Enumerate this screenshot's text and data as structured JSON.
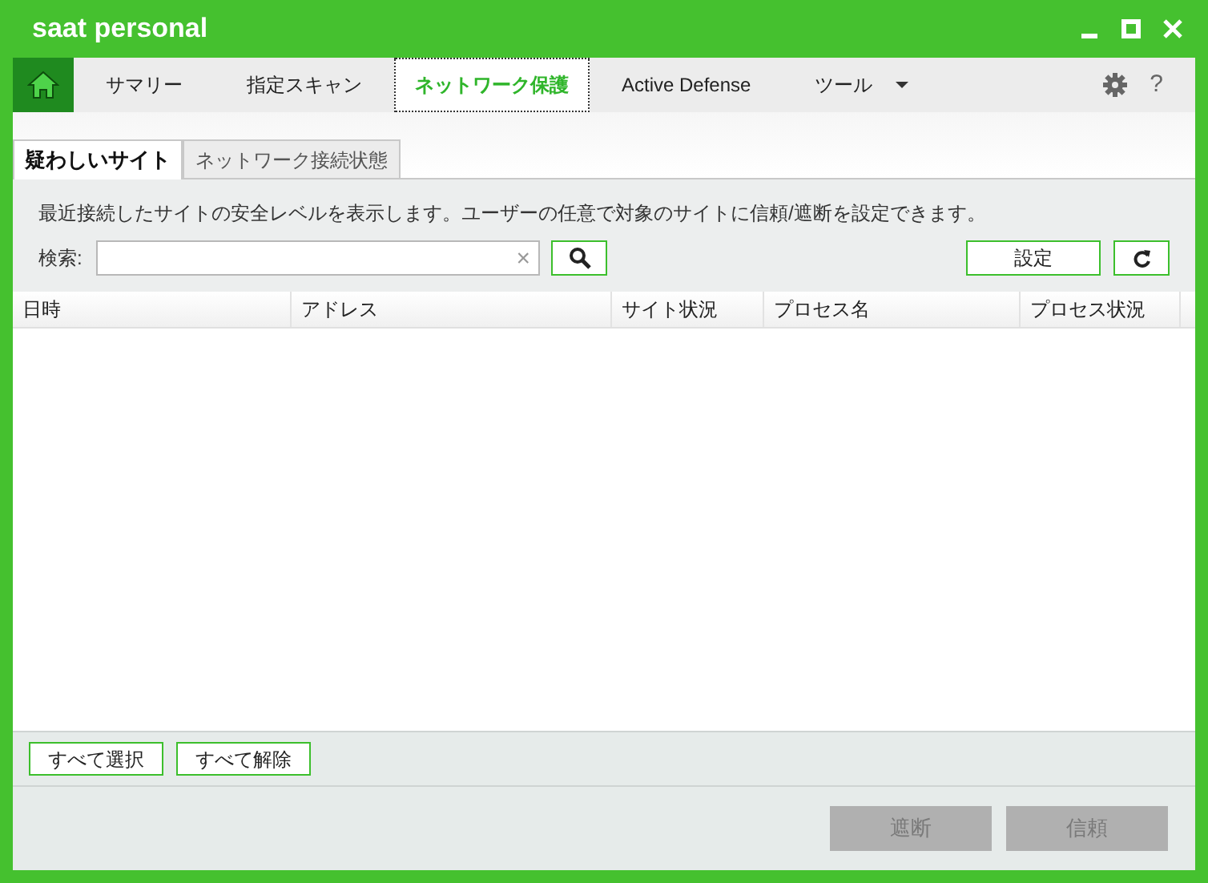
{
  "window": {
    "title": "saat personal"
  },
  "nav": {
    "tabs": [
      {
        "label": "サマリー",
        "selected": false,
        "dropdown": false
      },
      {
        "label": "指定スキャン",
        "selected": false,
        "dropdown": false
      },
      {
        "label": "ネットワーク保護",
        "selected": true,
        "dropdown": false
      },
      {
        "label": "Active Defense",
        "selected": false,
        "dropdown": false
      },
      {
        "label": "ツール",
        "selected": false,
        "dropdown": true
      }
    ],
    "help": "?"
  },
  "subtabs": [
    {
      "label": "疑わしいサイト",
      "selected": true
    },
    {
      "label": "ネットワーク接続状態",
      "selected": false
    }
  ],
  "description": "最近接続したサイトの安全レベルを表示します。ユーザーの任意で対象のサイトに信頼/遮断を設定できます。",
  "search": {
    "label": "検索:",
    "clear": "×"
  },
  "settings_button": "設定",
  "table": {
    "columns": [
      "日時",
      "アドレス",
      "サイト状況",
      "プロセス名",
      "プロセス状況"
    ]
  },
  "selection_buttons": [
    "すべて選択",
    "すべて解除"
  ],
  "action_buttons": [
    {
      "label": "遮断",
      "disabled": true
    },
    {
      "label": "信頼",
      "disabled": true
    }
  ]
}
